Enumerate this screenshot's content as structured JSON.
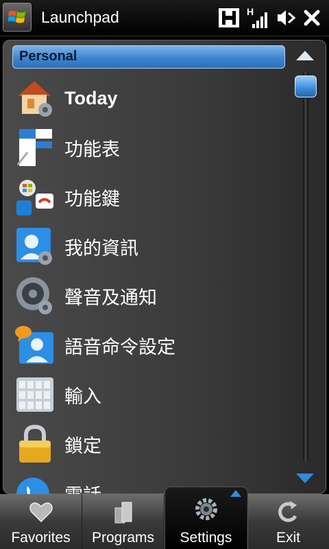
{
  "window": {
    "title": "Launchpad"
  },
  "status_icons": [
    "h-data-icon",
    "signal-strength-icon",
    "speaker-muted-icon",
    "close-icon"
  ],
  "list": {
    "section": "Personal",
    "items": [
      {
        "label": "Today",
        "icon": "today-house-gear-icon"
      },
      {
        "label": "功能表",
        "icon": "menu-settings-icon"
      },
      {
        "label": "功能鍵",
        "icon": "softkeys-icon"
      },
      {
        "label": "我的資訊",
        "icon": "owner-info-icon"
      },
      {
        "label": "聲音及通知",
        "icon": "sounds-notifications-icon"
      },
      {
        "label": "語音命令設定",
        "icon": "voice-command-icon"
      },
      {
        "label": "輸入",
        "icon": "input-keyboard-icon"
      },
      {
        "label": "鎖定",
        "icon": "lock-icon"
      },
      {
        "label": "電話",
        "icon": "phone-icon"
      }
    ]
  },
  "tabs": [
    {
      "label": "Favorites",
      "icon": "heart-icon"
    },
    {
      "label": "Programs",
      "icon": "programs-icon"
    },
    {
      "label": "Settings",
      "icon": "gear-icon",
      "active": true
    },
    {
      "label": "Exit",
      "icon": "exit-arrow-icon"
    }
  ],
  "colors": {
    "accent": "#2f8be0",
    "header": "#3d85cf"
  }
}
